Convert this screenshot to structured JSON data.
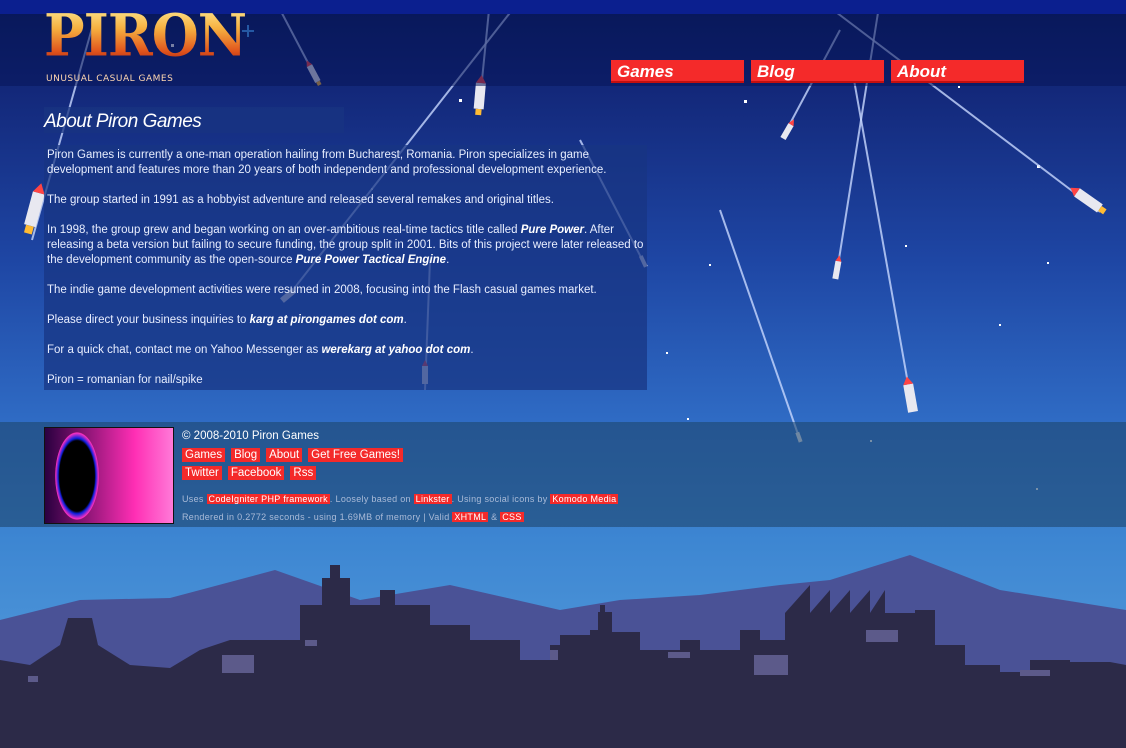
{
  "logo": {
    "word": "PIRON",
    "tagline": "UNUSUAL CASUAL GAMES"
  },
  "nav": [
    {
      "label": "Games"
    },
    {
      "label": "Blog"
    },
    {
      "label": "About"
    }
  ],
  "page": {
    "title": "About Piron Games",
    "paragraphs": {
      "p1": "Piron Games is currently a one-man operation hailing from Bucharest, Romania. Piron specializes in game development and features more than 20 years of both independent and professional development experience.",
      "p2": "The group started in 1991 as a hobbyist adventure and released several remakes and original titles.",
      "p3_a": "In 1998, the group grew and began working on an over-ambitious real-time tactics title called ",
      "p3_b": "Pure Power",
      "p3_c": ". After releasing a beta version but failing to secure funding, the group split in 2001. Bits of this project were later released to the development community as the open-source ",
      "p3_d": "Pure Power Tactical Engine",
      "p3_e": ".",
      "p4": "The indie game development activities were resumed in 2008, focusing into the Flash casual games market.",
      "p5_a": "Please direct your business inquiries to ",
      "p5_b": "karg at pirongames dot com",
      "p5_c": ".",
      "p6_a": "For a quick chat, contact me on Yahoo Messenger as ",
      "p6_b": "werekarg at yahoo dot com",
      "p6_c": ".",
      "p7": "Piron = romanian for nail/spike"
    }
  },
  "footer": {
    "copyright": "© 2008-2010 Piron Games",
    "links_row1": [
      "Games",
      "Blog",
      "About",
      "Get Free Games!"
    ],
    "links_row2": [
      "Twitter",
      "Facebook",
      "Rss"
    ],
    "credits1": {
      "a": "Uses ",
      "link1": "CodeIgniter PHP framework",
      "b": ". Loosely based on ",
      "link2": "Linkster",
      "c": ". Using social icons by ",
      "link3": "Komodo Media"
    },
    "credits2": {
      "a": "Rendered in 0.2772 seconds - using 1.69MB of memory | Valid ",
      "link1": "XHTML",
      "b": " & ",
      "link2": "CSS"
    }
  },
  "colors": {
    "accent": "#f42a2a",
    "panel": "#183482",
    "skyline": "#2c2a48",
    "mountain": "#4a5296"
  }
}
